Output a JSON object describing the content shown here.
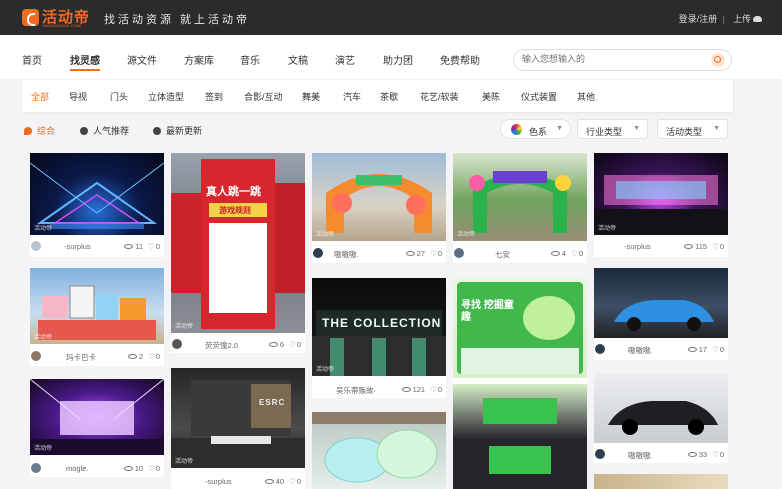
{
  "brand": {
    "name": "活动帝",
    "domain": "HUODONGDI.COM",
    "slogan": "找活动资源  就上活动帝"
  },
  "account": {
    "login": "登录/注册",
    "separator": "|",
    "upload": "上传"
  },
  "nav": [
    {
      "label": "首页"
    },
    {
      "label": "找灵感",
      "active": true
    },
    {
      "label": "源文件"
    },
    {
      "label": "方案库"
    },
    {
      "label": "音乐"
    },
    {
      "label": "文稿"
    },
    {
      "label": "演艺"
    },
    {
      "label": "助力团"
    },
    {
      "label": "免费帮助"
    }
  ],
  "search": {
    "placeholder": "输入您想输入的"
  },
  "categories": [
    {
      "label": "全部",
      "active": true
    },
    {
      "label": "导视"
    },
    {
      "label": "门头"
    },
    {
      "label": "立体造型"
    },
    {
      "label": "签到"
    },
    {
      "label": "合影/互动"
    },
    {
      "label": "舞美"
    },
    {
      "label": "汽车"
    },
    {
      "label": "茶歇"
    },
    {
      "label": "花艺/软装"
    },
    {
      "label": "美陈"
    },
    {
      "label": "仪式装置"
    },
    {
      "label": "其他"
    }
  ],
  "sort": [
    {
      "label": "综合",
      "active": true
    },
    {
      "label": "人气推荐"
    },
    {
      "label": "最新更新"
    }
  ],
  "filters": {
    "color": "色系",
    "industry": "行业类型",
    "activity": "活动类型"
  },
  "watermark": "活动帝",
  "cards": [
    {
      "author": "-surplus",
      "views": "11",
      "likes": "0"
    },
    {
      "author": "玛卡巴卡",
      "views": "2",
      "likes": "0"
    },
    {
      "author": "mogle.",
      "views": "10",
      "likes": "0"
    },
    {
      "author": "荧荧憧2.0",
      "views": "6",
      "likes": "0"
    },
    {
      "author": "-surplus",
      "views": "40",
      "likes": "0"
    },
    {
      "author": "嗷嗷嗷.",
      "views": "27",
      "likes": "0"
    },
    {
      "author": "吴乐蒂贩故·",
      "views": "121",
      "likes": "0"
    },
    {
      "author": "七安",
      "views": "4",
      "likes": "0"
    },
    {
      "author": "-surplus",
      "views": "115",
      "likes": "0"
    },
    {
      "author": "嗷嗷嗷.",
      "views": "17",
      "likes": "0"
    },
    {
      "author": "嗷嗷嗷.",
      "views": "33",
      "likes": "0"
    }
  ],
  "image_text": {
    "standee_title": "真人跳一跳",
    "standee_rule": "游戏规则",
    "building_sign": "THE COLLECTION",
    "green_poster": "寻找 挖掘童趣",
    "stage_sign": "ESRC"
  },
  "colors": {
    "accent": "#f36a21",
    "topbar": "#2b2b2d"
  }
}
